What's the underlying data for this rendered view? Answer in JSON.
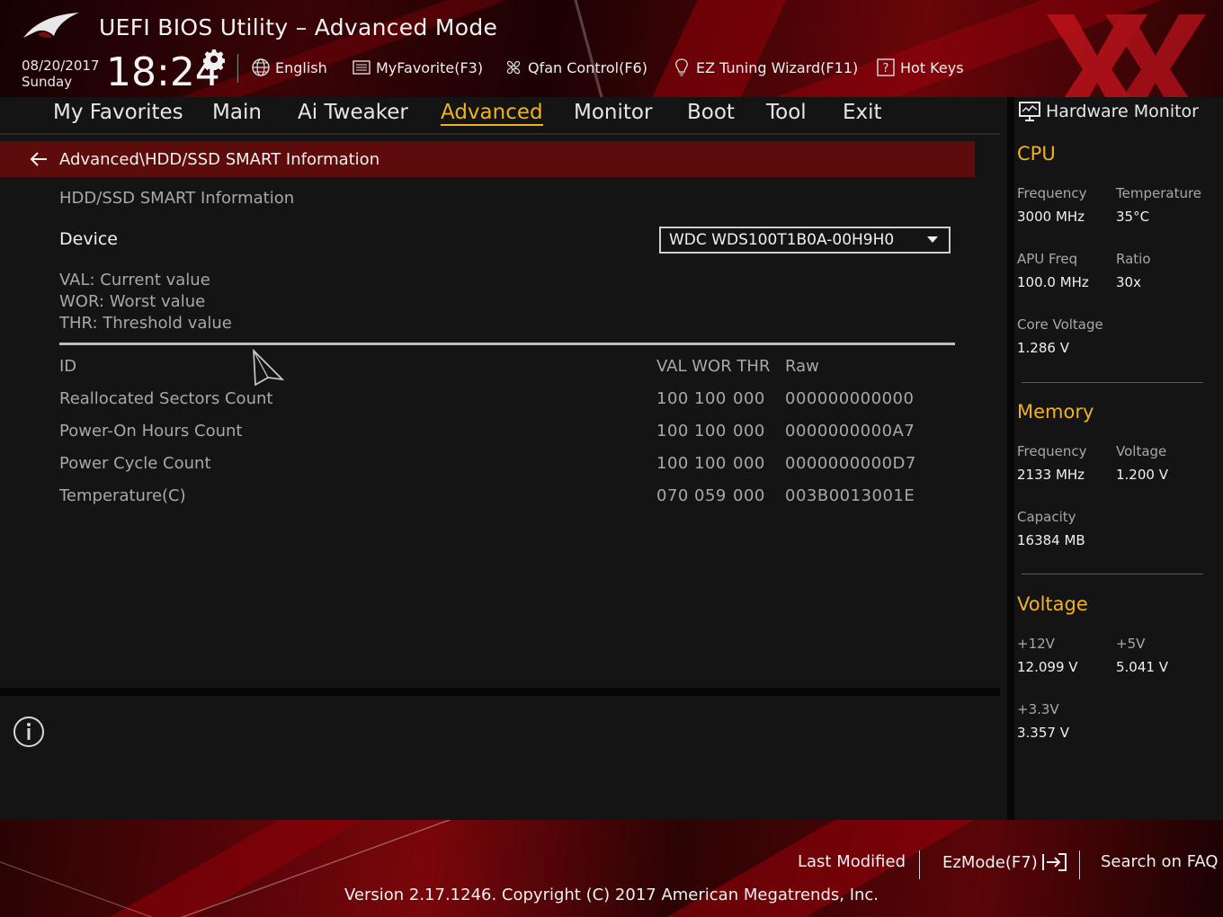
{
  "header": {
    "title": "UEFI BIOS Utility – Advanced Mode",
    "date": "08/20/2017",
    "day": "Sunday",
    "time": "18:24",
    "language": "English",
    "my_favorite": "MyFavorite(F3)",
    "qfan": "Qfan Control(F6)",
    "ez_tuning": "EZ Tuning Wizard(F11)",
    "hot_keys": "Hot Keys"
  },
  "menu": {
    "items": [
      "My Favorites",
      "Main",
      "Ai Tweaker",
      "Advanced",
      "Monitor",
      "Boot",
      "Tool",
      "Exit"
    ],
    "active": "Advanced"
  },
  "breadcrumb": "Advanced\\HDD/SSD SMART Information",
  "content": {
    "section_title": "HDD/SSD SMART Information",
    "device_label": "Device",
    "device_value": "WDC WDS100T1B0A-00H9H0",
    "legend": [
      "VAL:  Current value",
      "WOR: Worst value",
      "THR:  Threshold value"
    ],
    "columns": {
      "id": "ID",
      "valworthr": "VAL WOR THR",
      "raw": "Raw"
    },
    "rows": [
      {
        "name": "Reallocated Sectors Count",
        "val": "100",
        "wor": "100",
        "thr": "000",
        "raw": "000000000000"
      },
      {
        "name": "Power-On Hours Count",
        "val": "100",
        "wor": "100",
        "thr": "000",
        "raw": "0000000000A7"
      },
      {
        "name": "Power Cycle Count",
        "val": "100",
        "wor": "100",
        "thr": "000",
        "raw": "0000000000D7"
      },
      {
        "name": "Temperature(C)",
        "val": "070",
        "wor": "059",
        "thr": "000",
        "raw": "003B0013001E"
      }
    ]
  },
  "hw_monitor": {
    "title": "Hardware Monitor",
    "cpu": {
      "heading": "CPU",
      "freq_label": "Frequency",
      "freq": "3000 MHz",
      "temp_label": "Temperature",
      "temp": "35°C",
      "apu_label": "APU Freq",
      "apu": "100.0 MHz",
      "ratio_label": "Ratio",
      "ratio": "30x",
      "core_label": "Core Voltage",
      "core": "1.286 V"
    },
    "memory": {
      "heading": "Memory",
      "freq_label": "Frequency",
      "freq": "2133 MHz",
      "volt_label": "Voltage",
      "volt": "1.200 V",
      "cap_label": "Capacity",
      "cap": "16384 MB"
    },
    "voltage": {
      "heading": "Voltage",
      "v12_label": "+12V",
      "v12": "12.099 V",
      "v5_label": "+5V",
      "v5": "5.041 V",
      "v33_label": "+3.3V",
      "v33": "3.357 V"
    }
  },
  "footer": {
    "last_modified": "Last Modified",
    "ezmode": "EzMode(F7)",
    "search_faq": "Search on FAQ",
    "version": "Version 2.17.1246. Copyright (C) 2017 American Megatrends, Inc."
  },
  "colors": {
    "accent": "#f0b21f",
    "crumb_bg": "#5e0b0c",
    "bg": "#141414"
  }
}
